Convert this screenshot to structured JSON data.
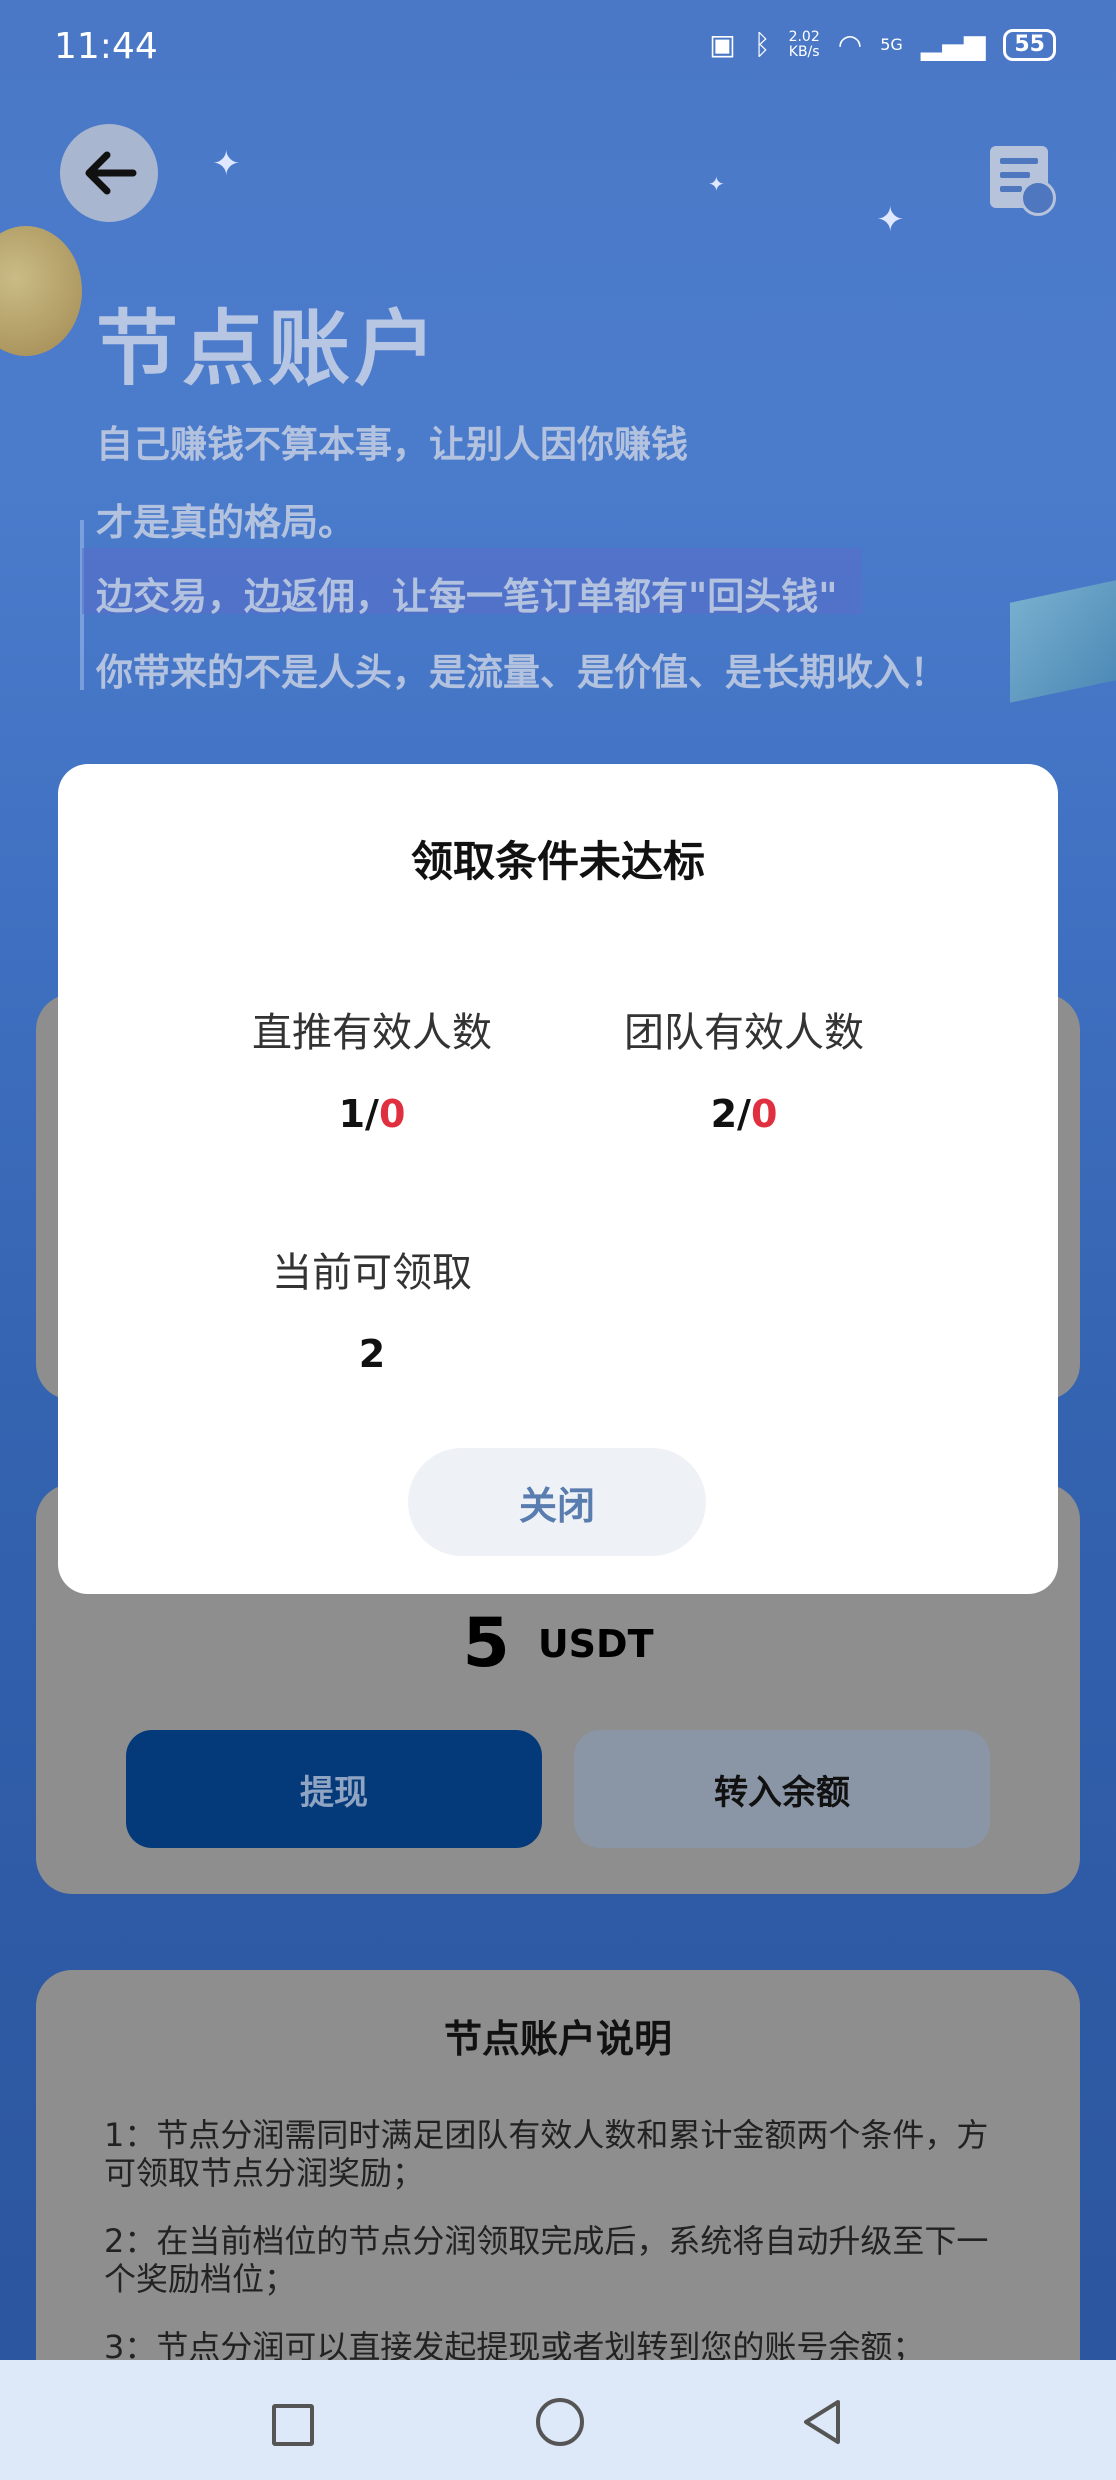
{
  "status_bar": {
    "time": "11:44",
    "net_speed_value": "2.02",
    "net_speed_unit": "KB/s",
    "network": "5G",
    "battery": "55"
  },
  "header": {
    "title": "节点账户",
    "lines": [
      "自己赚钱不算本事，让别人因你赚钱",
      "才是真的格局。",
      "边交易，边返佣，让每一笔订单都有\"回头钱\"",
      "你带来的不是人头，是流量、是价值、是长期收入！"
    ]
  },
  "balance": {
    "amount": "5",
    "unit": "USDT",
    "withdraw_label": "提现",
    "transfer_label": "转入余额"
  },
  "description": {
    "title": "节点账户说明",
    "items": [
      "1：节点分润需同时满足团队有效人数和累计金额两个条件，方可领取节点分润奖励；",
      "2：在当前档位的节点分润领取完成后，系统将自动升级至下一个奖励档位；",
      "3：节点分润可以直接发起提现或者划转到您的账号余额；"
    ]
  },
  "modal": {
    "title": "领取条件未达标",
    "direct_label": "直推有效人数",
    "direct_current": "1/",
    "direct_required": "0",
    "team_label": "团队有效人数",
    "team_current": "2/",
    "team_required": "0",
    "claimable_label": "当前可领取",
    "claimable_value": "2",
    "close_label": "关闭"
  },
  "icons": {
    "back": "arrow-left-icon",
    "records": "document-clock-icon",
    "nav_recent": "square-icon",
    "nav_home": "circle-icon",
    "nav_back": "triangle-left-icon"
  }
}
